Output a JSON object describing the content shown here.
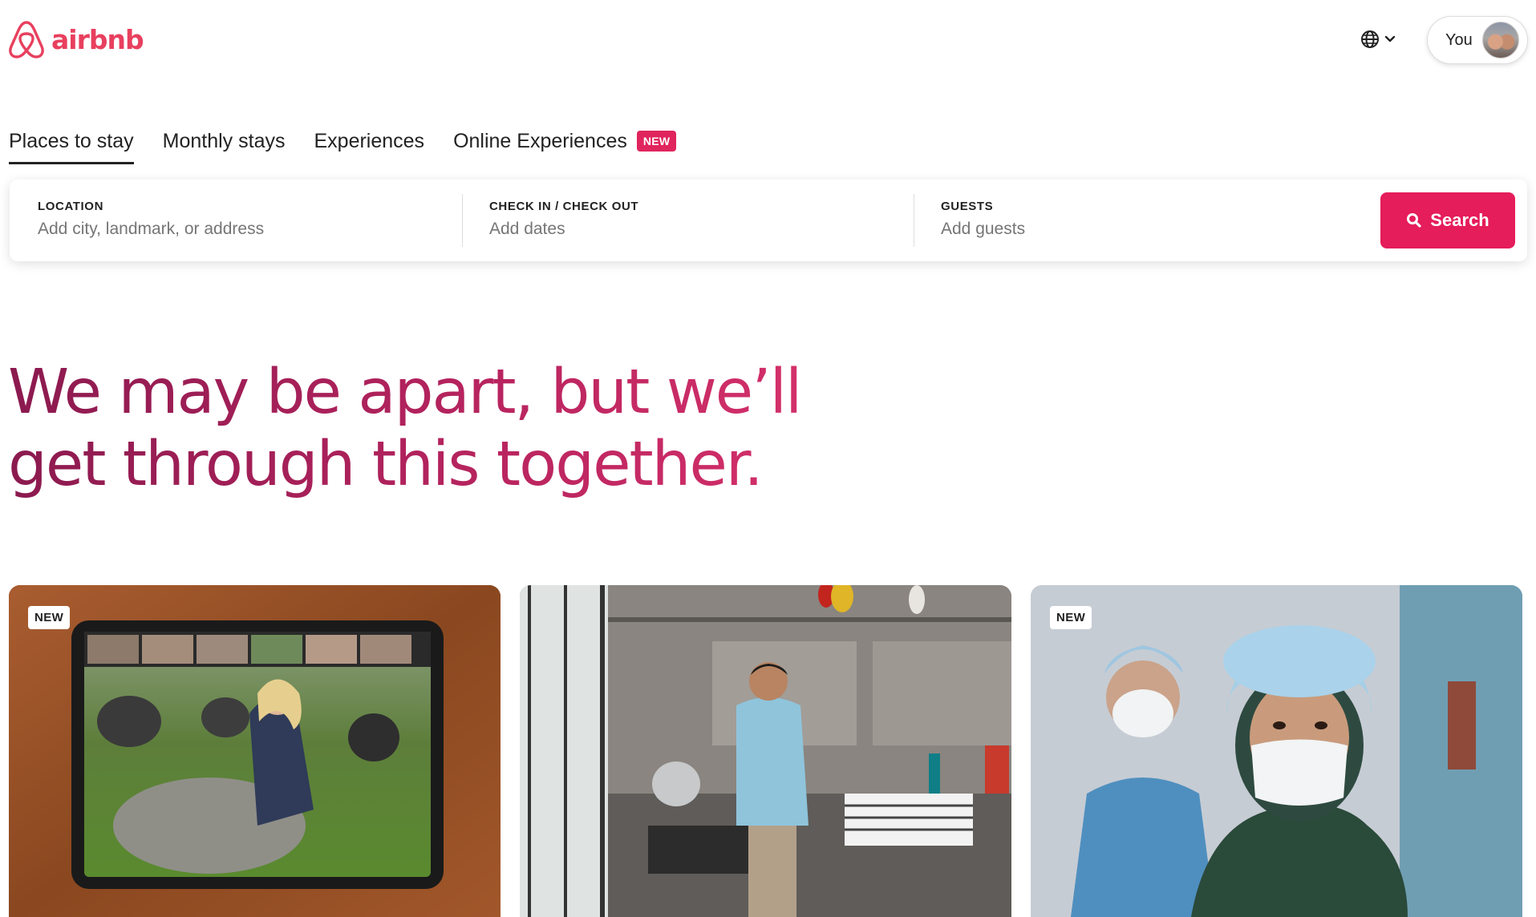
{
  "brand": {
    "name": "airbnb",
    "color": "#e8405e"
  },
  "header": {
    "globe_icon": "globe-icon",
    "user_label": "You"
  },
  "tabs": [
    {
      "label": "Places to stay",
      "active": true
    },
    {
      "label": "Monthly stays",
      "active": false
    },
    {
      "label": "Experiences",
      "active": false
    },
    {
      "label": "Online Experiences",
      "active": false,
      "badge": "NEW"
    }
  ],
  "search": {
    "location": {
      "label": "LOCATION",
      "placeholder": "Add city, landmark, or address"
    },
    "dates": {
      "label": "CHECK IN / CHECK OUT",
      "placeholder": "Add dates"
    },
    "guests": {
      "label": "GUESTS",
      "placeholder": "Add guests"
    },
    "button_label": "Search",
    "button_color": "#e51d5a"
  },
  "hero": {
    "line1": "We may be apart, but we’ll",
    "line2": "get through this together."
  },
  "cards": [
    {
      "badge": "NEW",
      "image": "tablet-video-call-with-sheep"
    },
    {
      "badge": "",
      "image": "man-in-kitchen-with-kettle"
    },
    {
      "badge": "NEW",
      "image": "healthcare-workers-with-masks"
    }
  ]
}
